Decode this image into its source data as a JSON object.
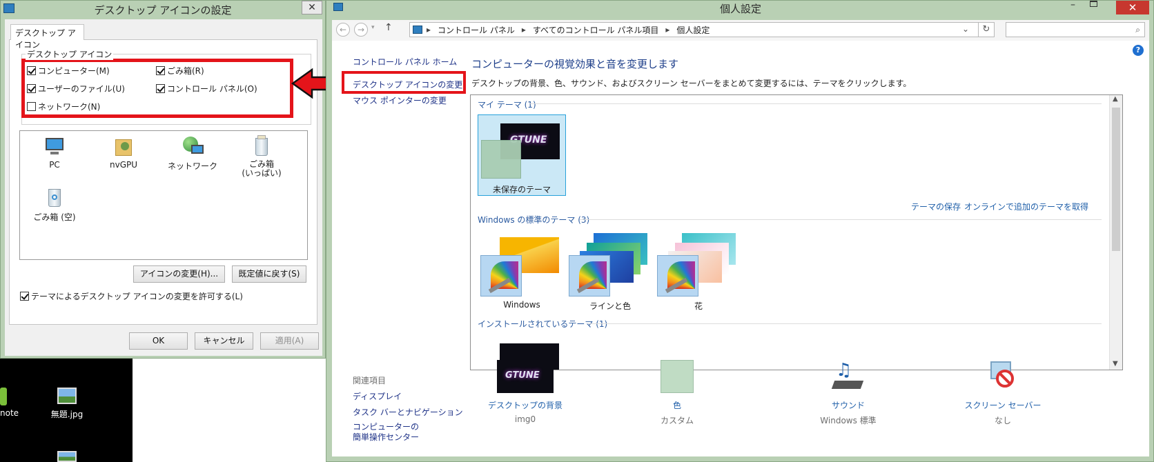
{
  "dialog": {
    "title": "デスクトップ アイコンの設定",
    "close_glyph": "✕",
    "tab_label": "デスクトップ アイコン",
    "group_label": "デスクトップ アイコン",
    "checkboxes": [
      {
        "label": "コンピューター(M)",
        "checked": true
      },
      {
        "label": "ごみ箱(R)",
        "checked": true
      },
      {
        "label": "ユーザーのファイル(U)",
        "checked": true
      },
      {
        "label": "コントロール パネル(O)",
        "checked": true
      },
      {
        "label": "ネットワーク(N)",
        "checked": false
      }
    ],
    "icons": [
      {
        "label": "PC",
        "icon": "computer-icon"
      },
      {
        "label": "nvGPU",
        "icon": "user-folder-icon"
      },
      {
        "label": "ネットワーク",
        "icon": "network-icon"
      },
      {
        "label": "ごみ箱\n(いっぱい)",
        "icon": "recycle-bin-full-icon"
      },
      {
        "label": "ごみ箱 (空)",
        "icon": "recycle-bin-empty-icon"
      }
    ],
    "change_icon_button": "アイコンの変更(H)...",
    "restore_default_button": "既定値に戻す(S)",
    "allow_themes_label": "テーマによるデスクトップ アイコンの変更を許可する(L)",
    "allow_themes_checked": true,
    "ok_button": "OK",
    "cancel_button": "キャンセル",
    "apply_button": "適用(A)"
  },
  "desktop": {
    "items": [
      {
        "label": "note"
      },
      {
        "label": "無題.jpg"
      }
    ]
  },
  "window": {
    "title": "個人設定",
    "address_path": [
      "コントロール パネル",
      "すべてのコントロール パネル項目",
      "個人設定"
    ],
    "search_placeholder": "",
    "sidebar": {
      "home": "コントロール パネル ホーム",
      "desktop_icons": "デスクトップ アイコンの変更",
      "mouse_pointers": "マウス ポインターの変更",
      "related_header": "関連項目",
      "related": [
        "ディスプレイ",
        "タスク バーとナビゲーション",
        "コンピューターの\n簡単操作センター"
      ]
    },
    "heading": "コンピューターの視覚効果と音を変更します",
    "subheading": "デスクトップの背景、色、サウンド、およびスクリーン セーバーをまとめて変更するには、テーマをクリックします。",
    "my_themes_title": "マイ テーマ (1)",
    "unsaved_theme_label": "未保存のテーマ",
    "save_theme_link": "テーマの保存",
    "online_themes_link": "オンラインで追加のテーマを取得",
    "default_themes_title": "Windows の標準のテーマ (3)",
    "default_themes": [
      "Windows",
      "ラインと色",
      "花"
    ],
    "installed_themes_title": "インストールされているテーマ (1)",
    "logo_text": "GTUNE",
    "bottom": [
      {
        "label": "デスクトップの背景",
        "value": "img0"
      },
      {
        "label": "色",
        "value": "カスタム"
      },
      {
        "label": "サウンド",
        "value": "Windows 標準"
      },
      {
        "label": "スクリーン セーバー",
        "value": "なし"
      }
    ]
  },
  "colors": {
    "accent_red": "#e4141a",
    "window_frame": "#b9d0b4",
    "link_blue": "#1f5fa9"
  }
}
